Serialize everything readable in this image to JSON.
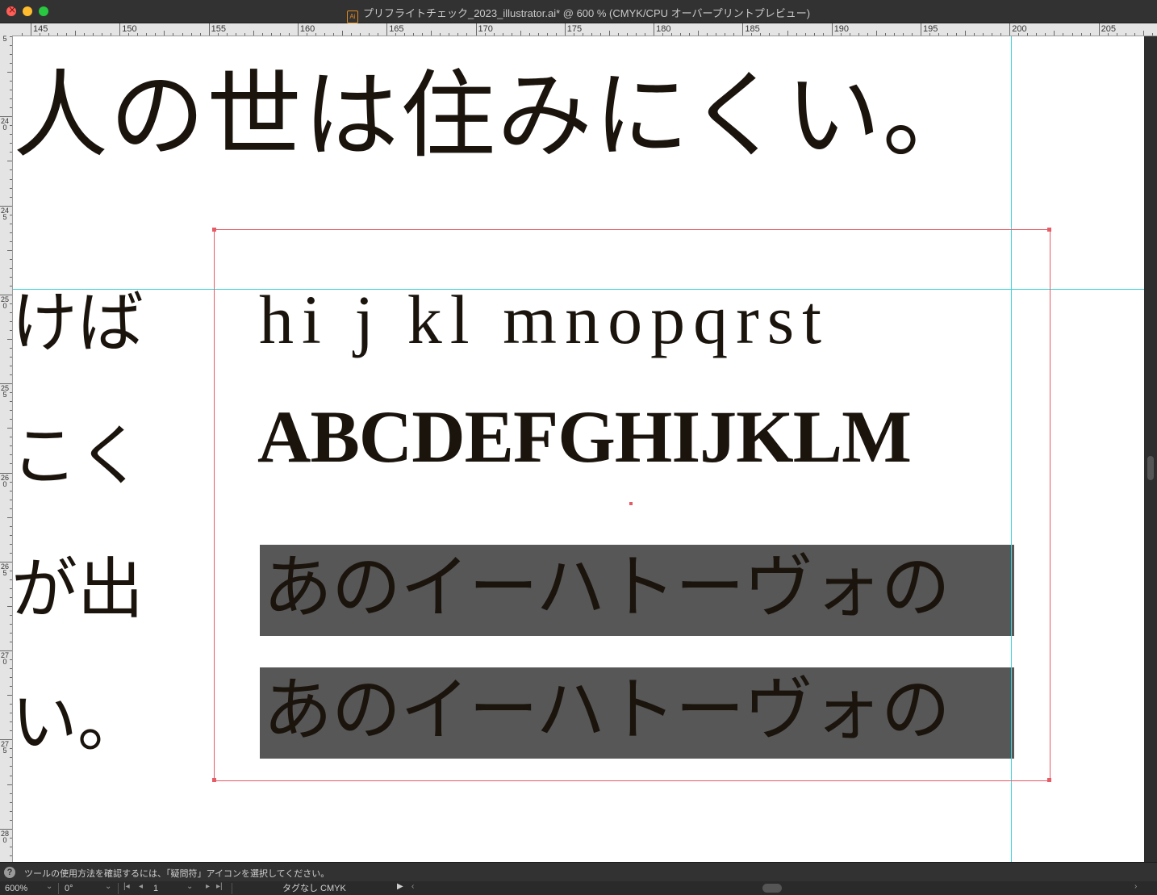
{
  "window": {
    "title": "プリフライトチェック_2023_illustrator.ai* @ 600 % (CMYK/CPU オーバープリントプレビュー)",
    "file_icon_label": "Ai"
  },
  "ruler_top": {
    "labels": [
      "145",
      "150",
      "155",
      "160",
      "165",
      "170",
      "175",
      "180",
      "185",
      "190",
      "195",
      "200",
      "205"
    ]
  },
  "ruler_left": {
    "labels": [
      "235",
      "240",
      "245",
      "250",
      "255",
      "260",
      "265",
      "270",
      "275",
      "280"
    ]
  },
  "artboard": {
    "jp_headline": "人の世は住みにくい。",
    "jp_vertical_fragments": [
      "けば",
      "こく",
      "が出",
      "い。"
    ],
    "latin_lower": "hi j kl mnopqrst",
    "latin_upper": "ABCDEFGHIJKLM",
    "jp_line_1": "あのイーハトーヴォの",
    "jp_line_2": "あのイーハトーヴォの",
    "jp_bar_color": "#575757",
    "selection_color": "#e65b66",
    "guide_color": "#3ad6dd"
  },
  "status": {
    "help_icon_glyph": "?",
    "message": "ツールの使用方法を確認するには、「疑問符」アイコンを選択してください。"
  },
  "bottom_bar": {
    "zoom": "600%",
    "rotation": "0°",
    "artboard_number": "1",
    "color_profile": "タグなし CMYK"
  }
}
